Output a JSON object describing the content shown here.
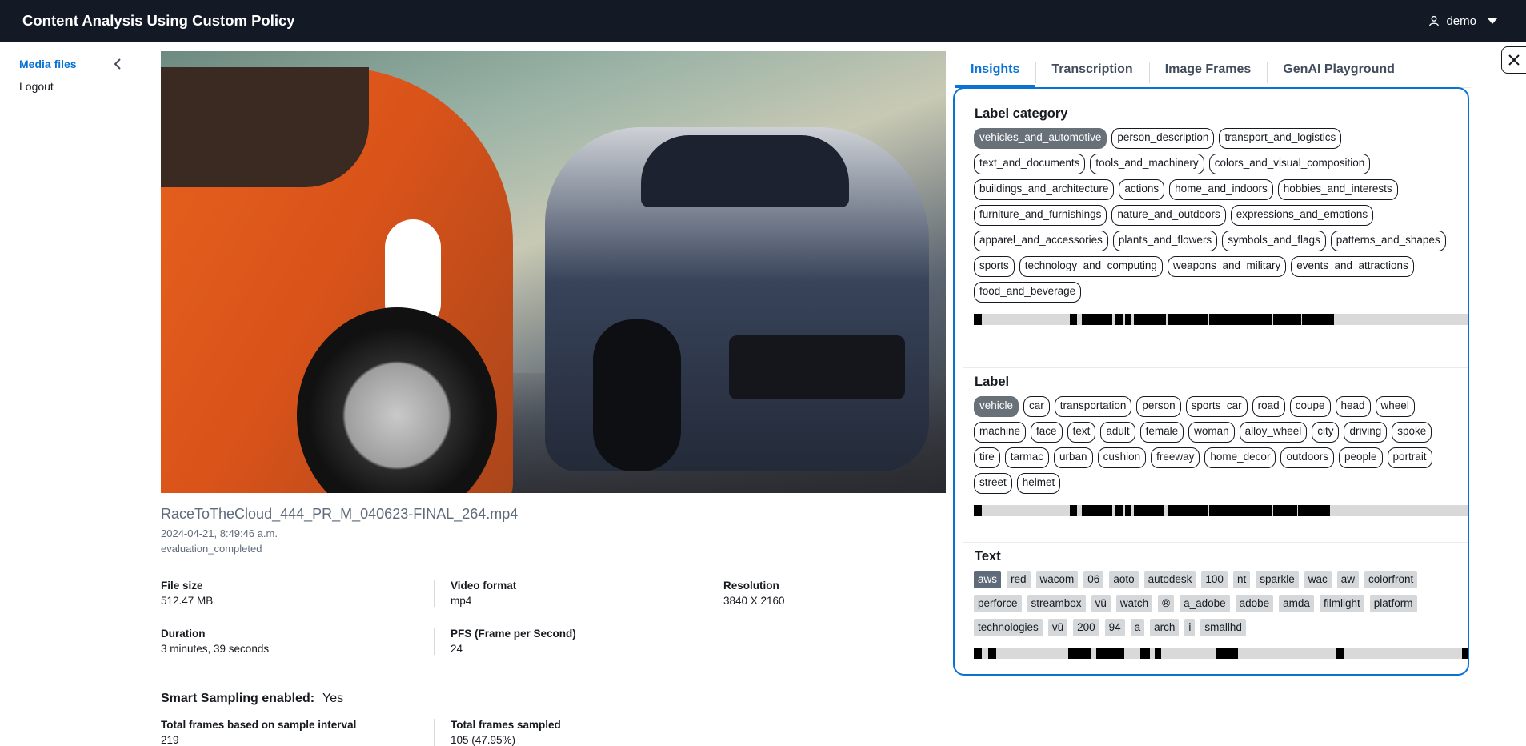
{
  "app": {
    "title": "Content Analysis Using Custom Policy",
    "user": "demo"
  },
  "sidebar": {
    "items": [
      {
        "label": "Media files"
      },
      {
        "label": "Logout"
      }
    ]
  },
  "video": {
    "filename": "RaceToTheCloud_444_PR_M_040623-FINAL_264.mp4",
    "date": "2024-04-21, 8:49:46 a.m.",
    "status": "evaluation_completed"
  },
  "details": {
    "row1": [
      {
        "label": "File size",
        "value": "512.47 MB"
      },
      {
        "label": "Video format",
        "value": "mp4"
      },
      {
        "label": "Resolution",
        "value": "3840 X 2160"
      }
    ],
    "row2": [
      {
        "label": "Duration",
        "value": "3 minutes, 39 seconds"
      },
      {
        "label": "PFS (Frame per Second)",
        "value": "24"
      }
    ],
    "smart_sampling": {
      "label": "Smart Sampling enabled:",
      "value": "Yes"
    },
    "row3": [
      {
        "label": "Total frames based on sample interval",
        "value": "219"
      },
      {
        "label": "Total frames sampled",
        "value": "105 (47.95%)"
      }
    ]
  },
  "tabs": [
    {
      "label": "Insights"
    },
    {
      "label": "Transcription"
    },
    {
      "label": "Image Frames"
    },
    {
      "label": "GenAI Playground"
    }
  ],
  "insights": {
    "label_category": {
      "title": "Label category",
      "chips": [
        "vehicles_and_automotive",
        "person_description",
        "transport_and_logistics",
        "text_and_documents",
        "tools_and_machinery",
        "colors_and_visual_composition",
        "buildings_and_architecture",
        "actions",
        "home_and_indoors",
        "hobbies_and_interests",
        "furniture_and_furnishings",
        "nature_and_outdoors",
        "expressions_and_emotions",
        "apparel_and_accessories",
        "plants_and_flowers",
        "symbols_and_flags",
        "patterns_and_shapes",
        "sports",
        "technology_and_computing",
        "weapons_and_military",
        "events_and_attractions",
        "food_and_beverage"
      ]
    },
    "label": {
      "title": "Label",
      "chips": [
        "vehicle",
        "car",
        "transportation",
        "person",
        "sports_car",
        "road",
        "coupe",
        "head",
        "wheel",
        "machine",
        "face",
        "text",
        "adult",
        "female",
        "woman",
        "alloy_wheel",
        "city",
        "driving",
        "spoke",
        "tire",
        "tarmac",
        "urban",
        "cushion",
        "freeway",
        "home_decor",
        "outdoors",
        "people",
        "portrait",
        "street",
        "helmet"
      ]
    },
    "text": {
      "title": "Text",
      "chips": [
        "aws",
        "red",
        "wacom",
        "06",
        "aoto",
        "autodesk",
        "100",
        "nt",
        "sparkle",
        "wac",
        "aw",
        "colorfront",
        "perforce",
        "streambox",
        "vū",
        "watch",
        "®",
        "a_adobe",
        "adobe",
        "amda",
        "filmlight",
        "platform",
        "technologies",
        "vū",
        "200",
        "94",
        "a",
        "arch",
        "i",
        "smallhd"
      ]
    }
  },
  "colors": {
    "accent": "#0972d3",
    "topbar": "#131a26",
    "chip_selected": "#687078"
  }
}
